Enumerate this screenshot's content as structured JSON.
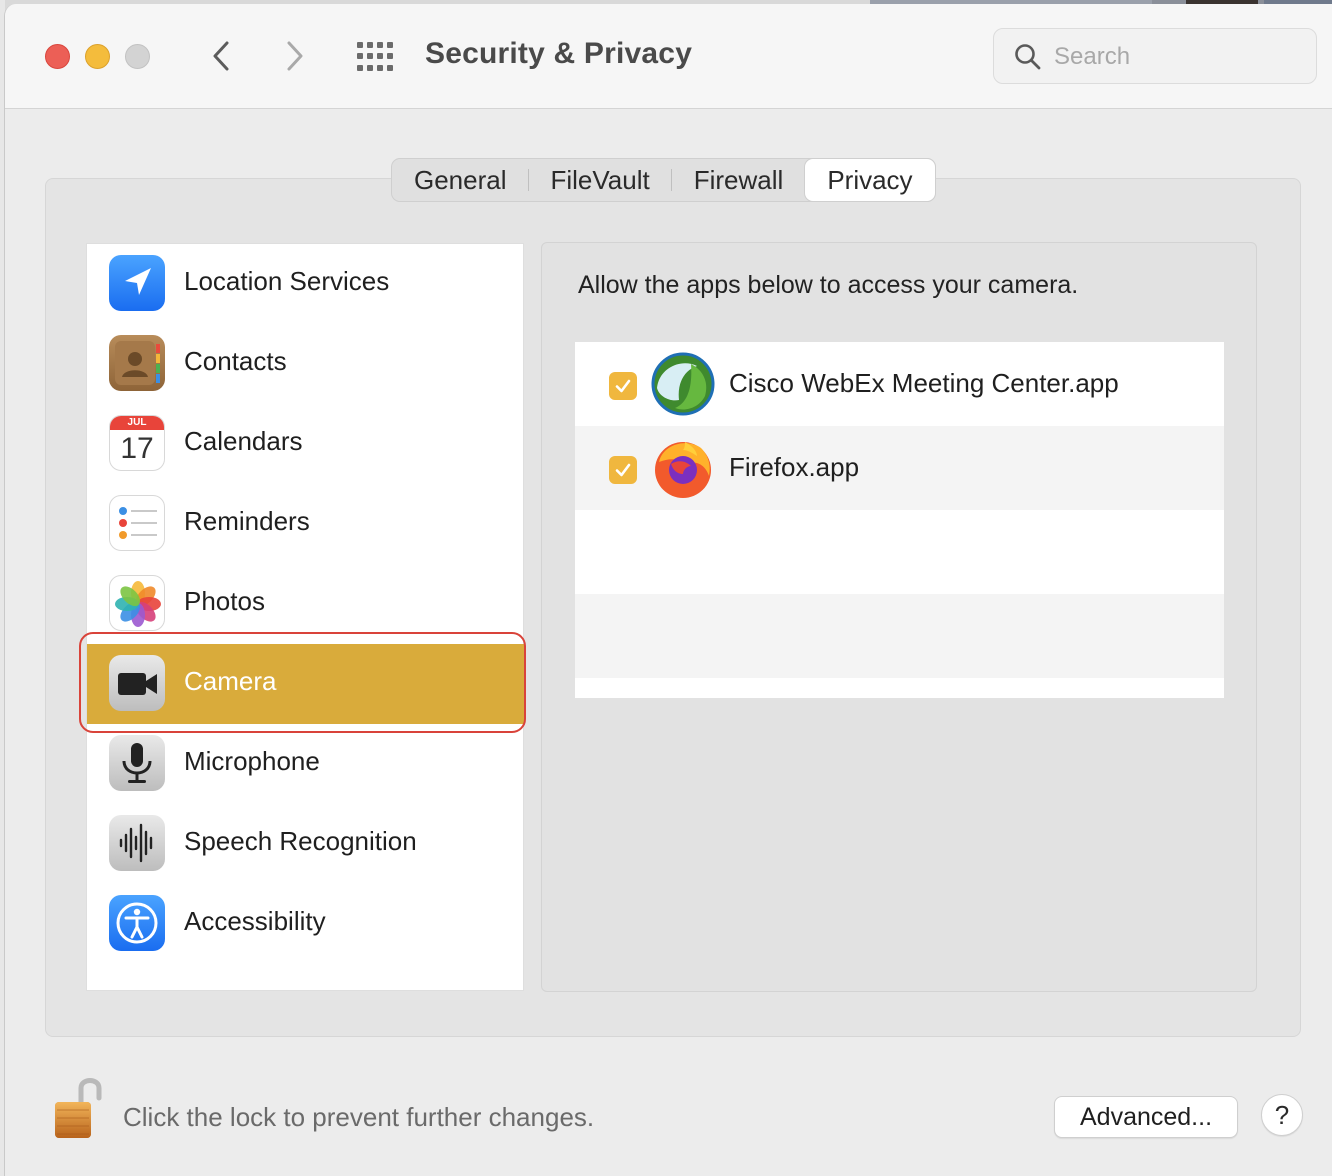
{
  "window": {
    "title": "Security & Privacy"
  },
  "toolbar": {
    "back_icon": "chevron-left-icon",
    "forward_icon": "chevron-right-icon",
    "grid_icon": "show-all-grid-icon"
  },
  "search": {
    "placeholder": "Search",
    "value": ""
  },
  "tabs": [
    {
      "label": "General",
      "active": false
    },
    {
      "label": "FileVault",
      "active": false
    },
    {
      "label": "Firewall",
      "active": false
    },
    {
      "label": "Privacy",
      "active": true
    }
  ],
  "categories": [
    {
      "label": "Location Services",
      "icon": "location-arrow-icon",
      "selected": false
    },
    {
      "label": "Contacts",
      "icon": "contacts-book-icon",
      "selected": false
    },
    {
      "label": "Calendars",
      "icon": "calendar-icon",
      "month": "JUL",
      "day": "17",
      "selected": false
    },
    {
      "label": "Reminders",
      "icon": "reminders-list-icon",
      "selected": false
    },
    {
      "label": "Photos",
      "icon": "photos-flower-icon",
      "selected": false
    },
    {
      "label": "Camera",
      "icon": "video-camera-icon",
      "selected": true
    },
    {
      "label": "Microphone",
      "icon": "microphone-icon",
      "selected": false
    },
    {
      "label": "Speech Recognition",
      "icon": "waveform-icon",
      "selected": false
    },
    {
      "label": "Accessibility",
      "icon": "accessibility-person-icon",
      "selected": false
    }
  ],
  "detail": {
    "description": "Allow the apps below to access your camera.",
    "apps": [
      {
        "name": "Cisco WebEx Meeting Center.app",
        "checked": true,
        "icon": "webex-icon"
      },
      {
        "name": "Firefox.app",
        "checked": true,
        "icon": "firefox-icon"
      }
    ]
  },
  "footer": {
    "lock_text": "Click the lock to prevent further changes.",
    "advanced_label": "Advanced...",
    "help_label": "?"
  },
  "colors": {
    "selection": "#d9ab3b",
    "checkbox": "#f0b73e",
    "highlight_ring": "#d9433a"
  }
}
